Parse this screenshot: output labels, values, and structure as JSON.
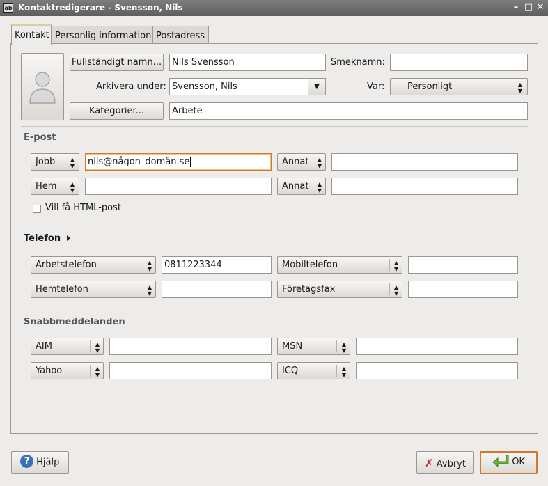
{
  "window": {
    "title": "Kontaktredigerare - Svensson, Nils",
    "icon_text": "ab",
    "minimize": "–",
    "maximize": "□",
    "close": "✕"
  },
  "tabs": [
    "Kontakt",
    "Personlig information",
    "Postadress"
  ],
  "identity": {
    "fullname_button": "Fullständigt namn...",
    "fullname_value": "Nils Svensson",
    "nickname_label": "Smeknamn:",
    "nickname_value": "",
    "fileas_label": "Arkivera under:",
    "fileas_value": "Svensson, Nils",
    "where_label": "Var:",
    "where_value": "Personligt",
    "categories_button": "Kategorier...",
    "categories_value": "Arbete"
  },
  "email": {
    "title": "E-post",
    "rows": [
      {
        "type": "Jobb",
        "value": "nils@någon_domän.se",
        "type2": "Annat",
        "value2": ""
      },
      {
        "type": "Hem",
        "value": "",
        "type2": "Annat",
        "value2": ""
      }
    ],
    "html_checkbox": "Vill få HTML-post",
    "html_checked": false
  },
  "phone": {
    "title": "Telefon",
    "rows": [
      {
        "type": "Arbetstelefon",
        "value": "0811223344",
        "type2": "Mobiltelefon",
        "value2": ""
      },
      {
        "type": "Hemtelefon",
        "value": "",
        "type2": "Företagsfax",
        "value2": ""
      }
    ]
  },
  "im": {
    "title": "Snabbmeddelanden",
    "rows": [
      {
        "type": "AIM",
        "value": "",
        "type2": "MSN",
        "value2": ""
      },
      {
        "type": "Yahoo",
        "value": "",
        "type2": "ICQ",
        "value2": ""
      }
    ]
  },
  "buttons": {
    "help": "Hjälp",
    "cancel": "Avbryt",
    "ok": "OK"
  }
}
